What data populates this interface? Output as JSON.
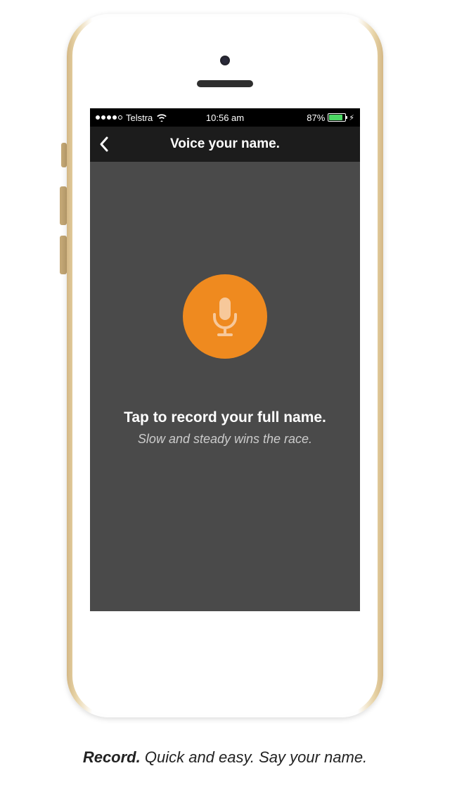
{
  "status_bar": {
    "carrier": "Telstra",
    "time": "10:56 am",
    "battery_percent": "87%"
  },
  "nav": {
    "title": "Voice your name."
  },
  "content": {
    "primary_text": "Tap to record your full name.",
    "secondary_text": "Slow and steady wins the race."
  },
  "caption": {
    "bold": "Record.",
    "rest": " Quick and easy. Say your name."
  },
  "colors": {
    "accent": "#ef8a1f",
    "dark_bg": "#4a4a4a",
    "nav_bg": "#1c1c1c"
  }
}
